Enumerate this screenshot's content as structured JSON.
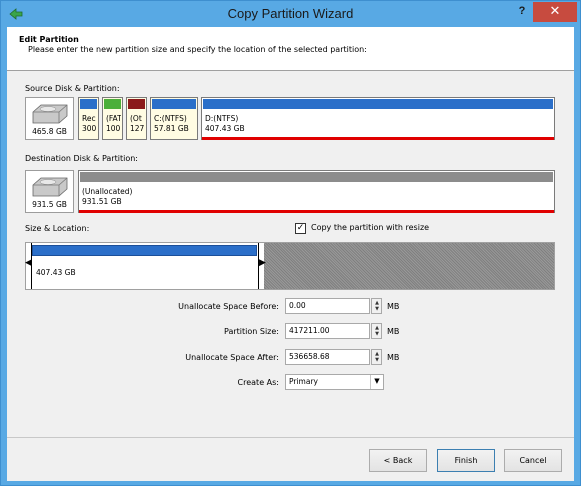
{
  "window": {
    "title": "Copy Partition Wizard",
    "help": "?",
    "close": "✕"
  },
  "header": {
    "title": "Edit Partition",
    "description": "Please enter the new partition size and specify the location of the selected partition:"
  },
  "source": {
    "label": "Source Disk & Partition:",
    "disk_size": "465.8 GB",
    "partitions": [
      {
        "line1": "Rec",
        "line2": "300",
        "bar_color": "#2b6fc9"
      },
      {
        "line1": "(FAT",
        "line2": "100",
        "bar_color": "#4caf3a"
      },
      {
        "line1": "(Ot",
        "line2": "127",
        "bar_color": "#8b1a1a"
      },
      {
        "line1": "C:(NTFS)",
        "line2": "57.81 GB",
        "bar_color": "#2b6fc9"
      },
      {
        "line1": "D:(NTFS)",
        "line2": "407.43 GB",
        "bar_color": "#2b6fc9"
      }
    ]
  },
  "destination": {
    "label": "Destination Disk & Partition:",
    "disk_size": "931.5 GB",
    "partition": {
      "line1": "(Unallocated)",
      "line2": "931.51 GB",
      "bar_color": "#8c8c8c"
    }
  },
  "size_location": {
    "label": "Size & Location:",
    "checkbox_label": "Copy the partition with resize",
    "checkbox_checked": true,
    "partition_size": "407.43 GB",
    "partition_fraction": 0.437
  },
  "form": {
    "unalloc_before_label": "Unallocate Space Before:",
    "unalloc_before_value": "0.00",
    "partition_size_label": "Partition Size:",
    "partition_size_value": "417211.00",
    "unalloc_after_label": "Unallocate Space After:",
    "unalloc_after_value": "536658.68",
    "unit": "MB",
    "create_as_label": "Create As:",
    "create_as_value": "Primary"
  },
  "buttons": {
    "back": "< Back",
    "finish": "Finish",
    "cancel": "Cancel"
  }
}
